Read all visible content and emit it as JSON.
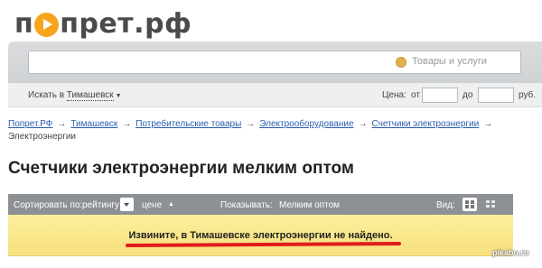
{
  "logo": {
    "text_before": "п",
    "text_after": "прет.рф"
  },
  "search": {
    "placeholder": "Товары и услуги",
    "icon": "search-logo-icon"
  },
  "filters": {
    "location_prefix": "Искать в",
    "location_city": "Тимашевск",
    "price_label": "Цена:",
    "from_label": "от",
    "to_label": "до",
    "currency": "руб.",
    "price_from": "",
    "price_to": ""
  },
  "breadcrumbs": {
    "items": [
      "Попрет.РФ",
      "Тимашевск",
      "Потребительские товары",
      "Электрооборудование",
      "Счетчики электроэнергии"
    ],
    "current": "Электроэнергии",
    "separator": "→"
  },
  "page": {
    "title": "Счетчики электроэнергии мелким оптом"
  },
  "sortbar": {
    "sort_label": "Сортировать по:",
    "sort_rating": "рейтингу",
    "sort_price": "цене",
    "sort_arrow": "▲",
    "show_label": "Показывать:",
    "show_value": "Мелким оптом",
    "view_label": "Вид:"
  },
  "notice": {
    "message": "Извините, в Тимашевске электроэнергии не найдено."
  },
  "watermark": {
    "text": "pikabu.ru"
  },
  "colors": {
    "accent": "#f6a51d",
    "link": "#2a5db0",
    "notice_bg": "#f9e78a",
    "underline": "#e21b1b"
  }
}
